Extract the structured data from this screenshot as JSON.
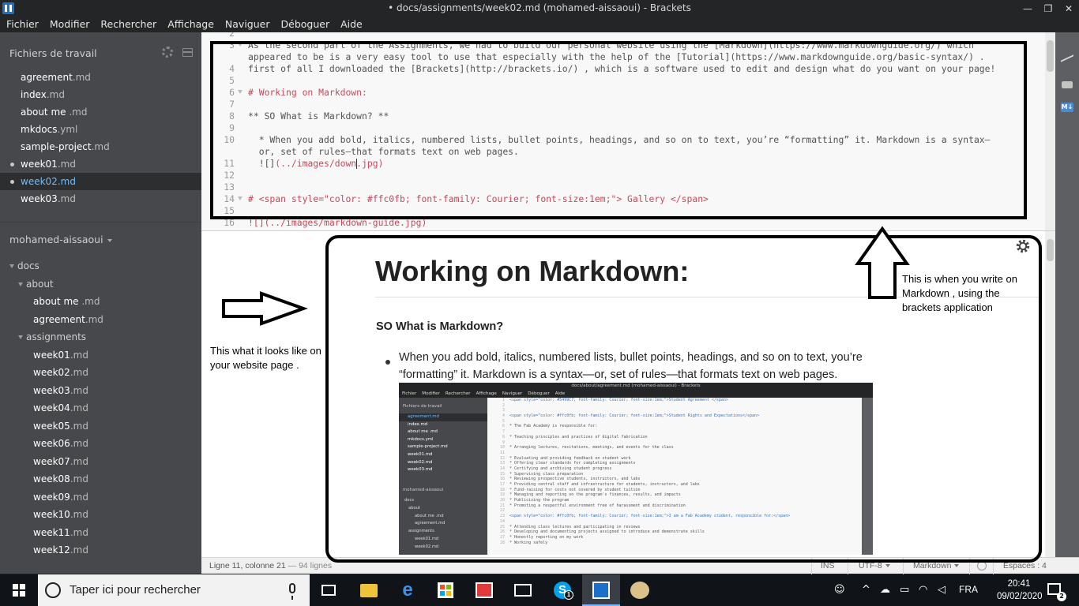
{
  "window": {
    "title": "• docs/assignments/week02.md (mohamed-aissaoui) - Brackets",
    "controls": [
      "—",
      "❐",
      "✕"
    ]
  },
  "menu": [
    "Fichier",
    "Modifier",
    "Rechercher",
    "Affichage",
    "Naviguer",
    "Déboguer",
    "Aide"
  ],
  "sidebar": {
    "working_files_label": "Fichiers de travail",
    "working_files": [
      {
        "name": "agreement",
        "ext": ".md",
        "dirty": false,
        "selected": false
      },
      {
        "name": "index",
        "ext": ".md",
        "dirty": false,
        "selected": false
      },
      {
        "name": "about me ",
        "ext": ".md",
        "dirty": false,
        "selected": false
      },
      {
        "name": "mkdocs",
        "ext": ".yml",
        "dirty": false,
        "selected": false
      },
      {
        "name": "sample-project",
        "ext": ".md",
        "dirty": false,
        "selected": false
      },
      {
        "name": "week01",
        "ext": ".md",
        "dirty": true,
        "selected": false
      },
      {
        "name": "week02",
        "ext": ".md",
        "dirty": true,
        "selected": true
      },
      {
        "name": "week03",
        "ext": ".md",
        "dirty": false,
        "selected": false
      }
    ],
    "project_name": "mohamed-aissaoui",
    "tree": [
      {
        "kind": "folder",
        "depth": 0,
        "name": "docs",
        "ext": ""
      },
      {
        "kind": "folder",
        "depth": 1,
        "name": "about",
        "ext": ""
      },
      {
        "kind": "file",
        "depth": 2,
        "name": "about me ",
        "ext": ".md"
      },
      {
        "kind": "file",
        "depth": 2,
        "name": "agreement",
        "ext": ".md"
      },
      {
        "kind": "folder",
        "depth": 1,
        "name": "assignments",
        "ext": ""
      },
      {
        "kind": "file",
        "depth": 2,
        "name": "week01",
        "ext": ".md"
      },
      {
        "kind": "file",
        "depth": 2,
        "name": "week02",
        "ext": ".md"
      },
      {
        "kind": "file",
        "depth": 2,
        "name": "week03",
        "ext": ".md"
      },
      {
        "kind": "file",
        "depth": 2,
        "name": "week04",
        "ext": ".md"
      },
      {
        "kind": "file",
        "depth": 2,
        "name": "week05",
        "ext": ".md"
      },
      {
        "kind": "file",
        "depth": 2,
        "name": "week06",
        "ext": ".md"
      },
      {
        "kind": "file",
        "depth": 2,
        "name": "week07",
        "ext": ".md"
      },
      {
        "kind": "file",
        "depth": 2,
        "name": "week08",
        "ext": ".md"
      },
      {
        "kind": "file",
        "depth": 2,
        "name": "week09",
        "ext": ".md"
      },
      {
        "kind": "file",
        "depth": 2,
        "name": "week10",
        "ext": ".md"
      },
      {
        "kind": "file",
        "depth": 2,
        "name": "week11",
        "ext": ".md"
      },
      {
        "kind": "file",
        "depth": 2,
        "name": "week12",
        "ext": ".md"
      }
    ]
  },
  "editor": {
    "lines": [
      {
        "num": "2",
        "fold": false,
        "cls": "",
        "text": ""
      },
      {
        "num": "3",
        "fold": true,
        "cls": "",
        "text": "As the second part of the Assignments, we had to build our personal website using the [Markdown](https://www.markdownguide.org/) which"
      },
      {
        "num": "",
        "fold": false,
        "cls": "",
        "text": "appeared to be is a very easy tool to use that especially with the help of the [Tutorial](https://www.markdownguide.org/basic-syntax/) ."
      },
      {
        "num": "4",
        "fold": false,
        "cls": "",
        "text": "first of all I downloaded the [Brackets](http://brackets.io/) , which is a software used to edit and design what do you want on your page!"
      },
      {
        "num": "5",
        "fold": false,
        "cls": "",
        "text": ""
      },
      {
        "num": "6",
        "fold": true,
        "cls": "red",
        "text": "# Working on Markdown:"
      },
      {
        "num": "7",
        "fold": false,
        "cls": "",
        "text": ""
      },
      {
        "num": "8",
        "fold": false,
        "cls": "",
        "text": "** SO What is Markdown? **"
      },
      {
        "num": "9",
        "fold": false,
        "cls": "",
        "text": ""
      },
      {
        "num": "10",
        "fold": false,
        "cls": "",
        "text": "  * When you add bold, italics, numbered lists, bullet points, headings, and so on to text, you’re “formatting” it. Markdown is a syntax—"
      },
      {
        "num": "",
        "fold": false,
        "cls": "",
        "text": "  or, set of rules—that formats text on web pages."
      },
      {
        "num": "11",
        "fold": false,
        "cls": "cursor-line",
        "text": "  ![](../images/down.jpg)"
      },
      {
        "num": "12",
        "fold": false,
        "cls": "",
        "text": ""
      },
      {
        "num": "13",
        "fold": false,
        "cls": "",
        "text": ""
      },
      {
        "num": "14",
        "fold": true,
        "cls": "red",
        "text": "# <span style=\"color: #ffc0fb; font-family: Courier; font-size:1em;\"> Gallery </span>"
      },
      {
        "num": "15",
        "fold": false,
        "cls": "",
        "text": ""
      },
      {
        "num": "16",
        "fold": false,
        "cls": "red",
        "text": "![](../images/markdown-guide.jpg)"
      }
    ]
  },
  "preview": {
    "h1": "Working on Markdown:",
    "h2": "SO What is Markdown?",
    "bullet": "When you add bold, italics, numbered lists, bullet points, headings, and so on to text, you’re “formatting” it. Markdown is a syntax—or, set of rules—that formats text on web pages."
  },
  "embedded": {
    "title": "docs/about/agreement.md (mohamed-aissaoui) - Brackets",
    "menu": [
      "Fichier",
      "Modifier",
      "Rechercher",
      "Affichage",
      "Naviguer",
      "Déboguer",
      "Aide"
    ],
    "working_files_label": "Fichiers de travail",
    "working_files": [
      "agreement.md",
      "index.md",
      "about me .md",
      "mkdocs.yml",
      "sample-project.md",
      "week01.md",
      "week02.md",
      "week03.md"
    ],
    "project_name": "mohamed-aissaoui",
    "tree": [
      "docs",
      "about",
      "about me .md",
      "agreement.md",
      "assignments",
      "week01.md",
      "week02.md"
    ],
    "code": [
      {
        "n": "1",
        "t": "<span style=\"color: #5499C7; font-family: Courier; font-size:1em;\">Student Agreement </span>",
        "c": "blue"
      },
      {
        "n": "2",
        "t": "",
        "c": ""
      },
      {
        "n": "3",
        "t": "",
        "c": ""
      },
      {
        "n": "4",
        "t": "<span style=\"color: #ffc0fb; font-family: Courier; font-size:1em;\">Student Rights and Expectations</span>",
        "c": "blue"
      },
      {
        "n": "5",
        "t": "",
        "c": ""
      },
      {
        "n": "6",
        "t": "* The Fab Academy is responsible for:",
        "c": ""
      },
      {
        "n": "7",
        "t": "",
        "c": ""
      },
      {
        "n": "8",
        "t": "* Teaching principles and practices of digital fabrication",
        "c": ""
      },
      {
        "n": "9",
        "t": "",
        "c": ""
      },
      {
        "n": "10",
        "t": "* Arranging lectures, recitations, meetings, and events for the class",
        "c": ""
      },
      {
        "n": "11",
        "t": "",
        "c": ""
      },
      {
        "n": "12",
        "t": "* Evaluating and providing feedback on student work",
        "c": ""
      },
      {
        "n": "13",
        "t": "* Offering clear standards for completing assignments",
        "c": ""
      },
      {
        "n": "14",
        "t": "* Certifying and archiving student progress",
        "c": ""
      },
      {
        "n": "15",
        "t": "* Supervising class preparation",
        "c": ""
      },
      {
        "n": "16",
        "t": "* Reviewing prospective students, instructors, and labs",
        "c": ""
      },
      {
        "n": "17",
        "t": "* Providing central staff and infrastructure for students, instructors, and labs",
        "c": ""
      },
      {
        "n": "18",
        "t": "* Fund-raising for costs not covered by student tuition",
        "c": ""
      },
      {
        "n": "19",
        "t": "* Managing and reporting on the program's finances, results, and impacts",
        "c": ""
      },
      {
        "n": "20",
        "t": "* Publicizing the program",
        "c": ""
      },
      {
        "n": "21",
        "t": "* Promoting a respectful environment free of harassment and discrimination",
        "c": ""
      },
      {
        "n": "22",
        "t": "",
        "c": ""
      },
      {
        "n": "23",
        "t": "<span style=\"color: #ffc0fb; font-family: Courier; font-size:1em;\">I am a Fab Academy student, responsible for:</span>",
        "c": "blue"
      },
      {
        "n": "24",
        "t": "",
        "c": ""
      },
      {
        "n": "25",
        "t": "* Attending class lectures and participating in reviews",
        "c": ""
      },
      {
        "n": "26",
        "t": "* Developing and documenting projects assigned to introduce and demonstrate skills",
        "c": ""
      },
      {
        "n": "27",
        "t": "* Honestly reporting on my work",
        "c": ""
      },
      {
        "n": "28",
        "t": "* Working safely",
        "c": ""
      }
    ]
  },
  "statusbar": {
    "position": "Ligne 11, colonne 21",
    "lines": " — 94 lignes",
    "ins": "INS",
    "encoding": "UTF-8",
    "language": "Markdown",
    "spaces": "Espaces : 4"
  },
  "annotations": {
    "editor_note": "This is when you write on Markdown , using the brackets application",
    "preview_note": "This what it looks like on your website page ."
  },
  "taskbar": {
    "search_placeholder": "Taper ici pour rechercher",
    "skype_badge": "1",
    "language": "FRA",
    "time": "20:41",
    "date": "09/02/2020",
    "notifications": "2"
  }
}
